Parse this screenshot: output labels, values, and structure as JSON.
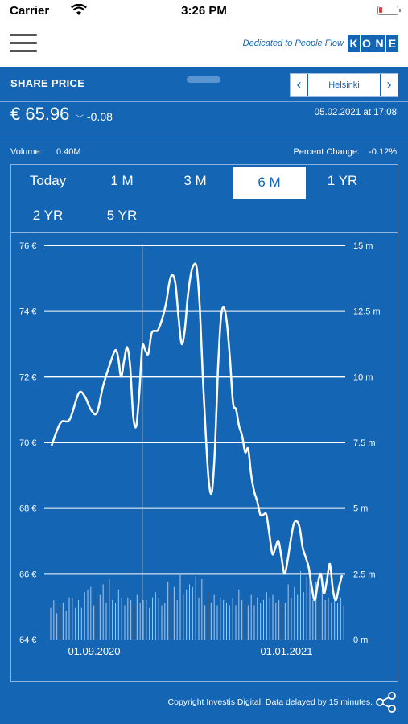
{
  "status": {
    "carrier": "Carrier",
    "time": "3:26 PM"
  },
  "header": {
    "tagline": "Dedicated to People Flow",
    "logo_letters": [
      "K",
      "O",
      "N",
      "E"
    ]
  },
  "share": {
    "title": "SHARE PRICE",
    "exchange": "Helsinki",
    "price": "€ 65.96",
    "change": "-0.08",
    "datetime": "05.02.2021 at 17:08",
    "volume_label": "Volume:",
    "volume_value": "0.40M",
    "percent_label": "Percent Change:",
    "percent_value": "-0.12%"
  },
  "tabs": [
    {
      "label": "Today"
    },
    {
      "label": "1 M"
    },
    {
      "label": "3 M"
    },
    {
      "label": "6 M",
      "active": true
    },
    {
      "label": "1 YR"
    },
    {
      "label": "2 YR"
    },
    {
      "label": "5 YR"
    }
  ],
  "chart_data": {
    "type": "line",
    "ylabel_left_ticks": [
      "64 €",
      "66 €",
      "68 €",
      "70 €",
      "72 €",
      "74 €",
      "76 €"
    ],
    "ylabel_right_ticks": [
      "0 m",
      "2.5 m",
      "5 m",
      "7.5 m",
      "10 m",
      "12.5 m",
      "15 m"
    ],
    "x_ticks": [
      "01.09.2020",
      "01.01.2021"
    ],
    "ylim": [
      64,
      76
    ],
    "volume_ylim": [
      0,
      15
    ],
    "grid": true,
    "series": [
      {
        "values": [
          [
            0,
            69.9
          ],
          [
            3,
            70.6
          ],
          [
            6,
            70.7
          ],
          [
            9,
            71.5
          ],
          [
            11,
            71.4
          ],
          [
            13,
            71.0
          ],
          [
            15,
            70.9
          ],
          [
            17,
            71.7
          ],
          [
            19,
            72.3
          ],
          [
            21,
            72.8
          ],
          [
            22,
            72.6
          ],
          [
            23,
            72.0
          ],
          [
            24,
            72.5
          ],
          [
            25,
            72.9
          ],
          [
            26,
            72.3
          ],
          [
            27,
            70.8
          ],
          [
            28,
            70.5
          ],
          [
            29,
            71.5
          ],
          [
            30,
            72.9
          ],
          [
            31,
            72.8
          ],
          [
            32,
            72.7
          ],
          [
            33,
            73.3
          ],
          [
            34,
            73.4
          ],
          [
            35,
            73.4
          ],
          [
            36,
            73.6
          ],
          [
            37,
            73.9
          ],
          [
            38,
            74.3
          ],
          [
            39,
            74.9
          ],
          [
            40,
            75.1
          ],
          [
            41,
            74.8
          ],
          [
            42,
            73.8
          ],
          [
            43,
            73.0
          ],
          [
            44,
            73.4
          ],
          [
            45,
            74.4
          ],
          [
            46,
            75.1
          ],
          [
            47,
            75.4
          ],
          [
            48,
            75.3
          ],
          [
            49,
            74.1
          ],
          [
            50,
            72.0
          ],
          [
            51,
            70.2
          ],
          [
            52,
            68.8
          ],
          [
            53,
            68.5
          ],
          [
            54,
            69.8
          ],
          [
            55,
            72.2
          ],
          [
            56,
            73.8
          ],
          [
            57,
            74.1
          ],
          [
            58,
            73.6
          ],
          [
            59,
            72.5
          ],
          [
            60,
            71.2
          ],
          [
            61,
            71.0
          ],
          [
            62,
            70.5
          ],
          [
            63,
            70.2
          ],
          [
            64,
            69.7
          ],
          [
            65,
            69.8
          ],
          [
            66,
            69.0
          ],
          [
            67,
            68.5
          ],
          [
            68,
            68.2
          ],
          [
            69,
            67.8
          ],
          [
            70,
            67.8
          ],
          [
            71,
            67.8
          ],
          [
            72,
            67.2
          ],
          [
            73,
            66.6
          ],
          [
            74,
            66.8
          ],
          [
            75,
            67.0
          ],
          [
            76,
            66.5
          ],
          [
            77,
            66.0
          ],
          [
            78,
            66.4
          ],
          [
            79,
            67.0
          ],
          [
            80,
            67.5
          ],
          [
            81,
            67.6
          ],
          [
            82,
            67.4
          ],
          [
            83,
            66.8
          ],
          [
            84,
            66.5
          ],
          [
            85,
            66.2
          ],
          [
            86,
            65.6
          ],
          [
            87,
            65.2
          ],
          [
            88,
            65.7
          ],
          [
            89,
            66.0
          ],
          [
            90,
            65.4
          ],
          [
            91,
            65.8
          ],
          [
            92,
            66.3
          ],
          [
            93,
            65.5
          ],
          [
            94,
            65.2
          ],
          [
            95,
            65.6
          ],
          [
            96,
            65.96
          ]
        ]
      }
    ],
    "volumes_m": [
      1.2,
      1.5,
      1.0,
      1.3,
      1.4,
      1.1,
      1.6,
      1.6,
      1.2,
      1.5,
      1.2,
      1.8,
      1.9,
      2.0,
      1.3,
      1.6,
      1.7,
      2.1,
      1.4,
      2.3,
      1.5,
      1.4,
      1.9,
      1.6,
      1.3,
      1.6,
      1.5,
      1.3,
      1.7,
      1.4,
      1.5,
      1.5,
      1.2,
      1.6,
      1.8,
      1.6,
      1.3,
      1.4,
      2.2,
      1.8,
      2.0,
      1.5,
      2.5,
      1.7,
      1.9,
      2.1,
      2.0,
      2.4,
      1.6,
      2.3,
      1.3,
      1.8,
      1.4,
      1.7,
      1.3,
      1.6,
      1.5,
      1.4,
      1.3,
      1.6,
      1.3,
      1.9,
      1.5,
      1.4,
      1.3,
      1.7,
      1.3,
      1.6,
      1.4,
      1.5,
      1.8,
      1.6,
      1.7,
      1.4,
      1.5,
      1.3,
      1.4,
      2.1,
      1.6,
      2.0,
      1.7,
      2.6,
      1.8,
      2.4,
      2.5,
      1.5,
      2.2,
      1.4,
      1.9,
      1.5,
      1.6,
      1.4,
      1.5,
      1.4,
      1.6,
      1.3
    ],
    "crosshair_x_index": 30
  },
  "footer": {
    "copyright": "Copyright Investis Digital. Data delayed by 15 minutes."
  }
}
